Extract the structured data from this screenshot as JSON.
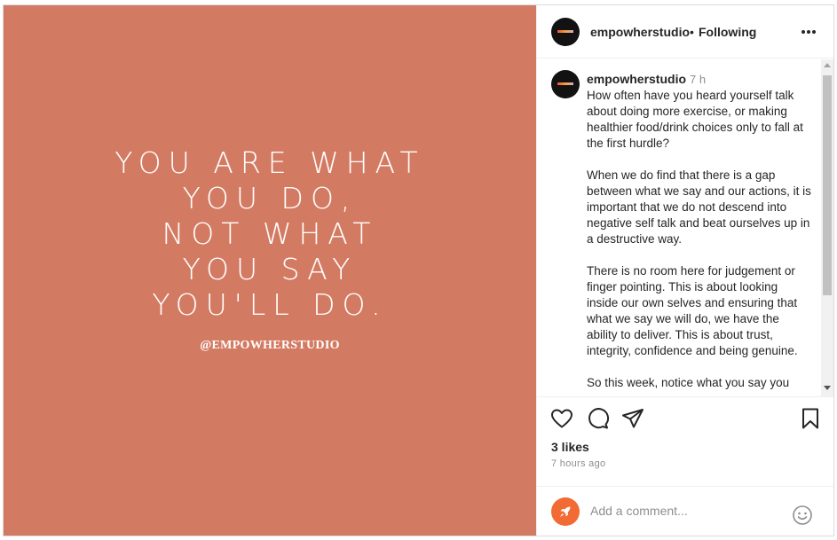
{
  "post": {
    "quote_lines": [
      "YOU ARE WHAT",
      "YOU DO,",
      "NOT WHAT",
      "YOU SAY",
      "YOU'LL DO."
    ],
    "watermark": "@EMPOWHERSTUDIO",
    "background_color": "#d37a62"
  },
  "header": {
    "username": "empowherstudio",
    "separator": "•",
    "follow_status": "Following",
    "more_icon": "more-horizontal-icon"
  },
  "caption": {
    "username": "empowherstudio",
    "time": "7 h",
    "text": "How often have you heard yourself talk about doing more exercise, or making healthier food/drink choices only to fall at the first hurdle?\n\nWhen we do find that there is a gap between what we say and our actions, it is important that we do not descend into negative self talk and beat ourselves up in a destructive way.\n\nThere is no room here for judgement or finger pointing. This is about looking inside our own selves and ensuring that what we say we will do, we have the ability to deliver. This is about trust, integrity, confidence and being genuine.\n\nSo this week, notice what you say you"
  },
  "actions": {
    "icons": [
      "heart-icon",
      "comment-icon",
      "share-icon",
      "bookmark-icon"
    ]
  },
  "stats": {
    "likes": "3 likes",
    "timestamp": "7 hours ago"
  },
  "comment": {
    "placeholder": "Add a comment...",
    "avatar_icon": "rocket-icon",
    "emoji_icon": "emoji-icon"
  },
  "colors": {
    "accent_orange": "#f26b35",
    "muted_text": "#8e8e8e"
  }
}
